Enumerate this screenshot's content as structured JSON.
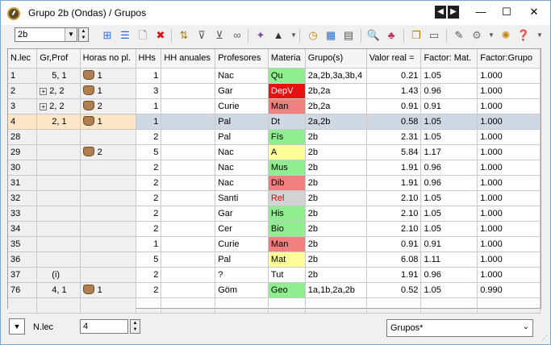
{
  "window": {
    "title": "Grupo 2b (Ondas) / Grupos",
    "nav_prev": "◀",
    "nav_next": "▶",
    "minimize": "—",
    "maximize": "☐",
    "close": "✕"
  },
  "toolbar": {
    "group_combo_value": "2b",
    "icons": [
      "new-row-icon",
      "list-icon",
      "new-document-icon",
      "delete-icon",
      "sort-icon",
      "filter-icon",
      "filter-add-icon",
      "link-icon",
      "magic-wand-icon",
      "graduation-cap-icon",
      "clock-icon",
      "timetable-icon",
      "matrix-icon",
      "search-icon",
      "people-icon",
      "copy-icon",
      "windows-icon",
      "edit-icon",
      "settings-icon",
      "gear-icon",
      "help-icon"
    ]
  },
  "grid": {
    "columns": [
      "N.lec",
      "Gr,Prof",
      "Horas no pl.",
      "HHs",
      "HH anuales",
      "Profesores",
      "Materia",
      "Grupo(s)",
      "Valor real =",
      "Factor: Mat.",
      "Factor:Grupo"
    ],
    "rows": [
      {
        "nlec": "1",
        "grprof": "5, 1",
        "expand": false,
        "hand": true,
        "horas": "1",
        "hhs": "1",
        "hhanual": "",
        "prof": "Nac",
        "materia": "Qu",
        "mcolor": "#90ee90",
        "mtext": "#000",
        "grupos": "2a,2b,3a,3b,4",
        "valor": "0.21",
        "fmat": "1.05",
        "fgrupo": "1.000",
        "sel": false
      },
      {
        "nlec": "2",
        "grprof": "2, 2",
        "expand": true,
        "hand": true,
        "horas": "1",
        "hhs": "3",
        "hhanual": "",
        "prof": "Gar",
        "materia": "DepV",
        "mcolor": "#e81010",
        "mtext": "#fff",
        "grupos": "2b,2a",
        "valor": "1.43",
        "fmat": "0.96",
        "fgrupo": "1.000",
        "sel": false
      },
      {
        "nlec": "3",
        "grprof": "2, 2",
        "expand": true,
        "hand": true,
        "horas": "2",
        "hhs": "1",
        "hhanual": "",
        "prof": "Curie",
        "materia": "Man",
        "mcolor": "#f08080",
        "mtext": "#000",
        "grupos": "2b,2a",
        "valor": "0.91",
        "fmat": "0.91",
        "fgrupo": "1.000",
        "sel": false
      },
      {
        "nlec": "4",
        "grprof": "2, 1",
        "expand": false,
        "hand": true,
        "horas": "1",
        "hhs": "1",
        "hhanual": "",
        "prof": "Pal",
        "materia": "Dt",
        "mcolor": "#cfd8e3",
        "mtext": "#000",
        "grupos": "2a,2b",
        "valor": "0.58",
        "fmat": "1.05",
        "fgrupo": "1.000",
        "sel": true
      },
      {
        "nlec": "28",
        "grprof": "",
        "expand": false,
        "hand": false,
        "horas": "",
        "hhs": "2",
        "hhanual": "",
        "prof": "Pal",
        "materia": "Fís",
        "mcolor": "#90ee90",
        "mtext": "#000",
        "grupos": "2b",
        "valor": "2.31",
        "fmat": "1.05",
        "fgrupo": "1.000",
        "sel": false
      },
      {
        "nlec": "29",
        "grprof": "",
        "expand": false,
        "hand": true,
        "horas": "2",
        "hhs": "5",
        "hhanual": "",
        "prof": "Nac",
        "materia": "A",
        "mcolor": "#ffff99",
        "mtext": "#000",
        "grupos": "2b",
        "valor": "5.84",
        "fmat": "1.17",
        "fgrupo": "1.000",
        "sel": false
      },
      {
        "nlec": "30",
        "grprof": "",
        "expand": false,
        "hand": false,
        "horas": "",
        "hhs": "2",
        "hhanual": "",
        "prof": "Nac",
        "materia": "Mus",
        "mcolor": "#90ee90",
        "mtext": "#000",
        "grupos": "2b",
        "valor": "1.91",
        "fmat": "0.96",
        "fgrupo": "1.000",
        "sel": false
      },
      {
        "nlec": "31",
        "grprof": "",
        "expand": false,
        "hand": false,
        "horas": "",
        "hhs": "2",
        "hhanual": "",
        "prof": "Nac",
        "materia": "Dib",
        "mcolor": "#f08080",
        "mtext": "#000",
        "grupos": "2b",
        "valor": "1.91",
        "fmat": "0.96",
        "fgrupo": "1.000",
        "sel": false
      },
      {
        "nlec": "32",
        "grprof": "",
        "expand": false,
        "hand": false,
        "horas": "",
        "hhs": "2",
        "hhanual": "",
        "prof": "Santi",
        "materia": "Rel",
        "mcolor": "#d3d3d3",
        "mtext": "#e00000",
        "grupos": "2b",
        "valor": "2.10",
        "fmat": "1.05",
        "fgrupo": "1.000",
        "sel": false
      },
      {
        "nlec": "33",
        "grprof": "",
        "expand": false,
        "hand": false,
        "horas": "",
        "hhs": "2",
        "hhanual": "",
        "prof": "Gar",
        "materia": "His",
        "mcolor": "#90ee90",
        "mtext": "#000",
        "grupos": "2b",
        "valor": "2.10",
        "fmat": "1.05",
        "fgrupo": "1.000",
        "sel": false
      },
      {
        "nlec": "34",
        "grprof": "",
        "expand": false,
        "hand": false,
        "horas": "",
        "hhs": "2",
        "hhanual": "",
        "prof": "Cer",
        "materia": "Bio",
        "mcolor": "#90ee90",
        "mtext": "#000",
        "grupos": "2b",
        "valor": "2.10",
        "fmat": "1.05",
        "fgrupo": "1.000",
        "sel": false
      },
      {
        "nlec": "35",
        "grprof": "",
        "expand": false,
        "hand": false,
        "horas": "",
        "hhs": "1",
        "hhanual": "",
        "prof": "Curie",
        "materia": "Man",
        "mcolor": "#f08080",
        "mtext": "#000",
        "grupos": "2b",
        "valor": "0.91",
        "fmat": "0.91",
        "fgrupo": "1.000",
        "sel": false
      },
      {
        "nlec": "36",
        "grprof": "",
        "expand": false,
        "hand": false,
        "horas": "",
        "hhs": "5",
        "hhanual": "",
        "prof": "Pal",
        "materia": "Mat",
        "mcolor": "#ffff99",
        "mtext": "#000",
        "grupos": "2b",
        "valor": "6.08",
        "fmat": "1.11",
        "fgrupo": "1.000",
        "sel": false
      },
      {
        "nlec": "37",
        "grprof": "(i)",
        "expand": false,
        "hand": false,
        "horas": "",
        "hhs": "2",
        "hhanual": "",
        "prof": "?",
        "materia": "Tut",
        "mcolor": "#ffffff",
        "mtext": "#000",
        "grupos": "2b",
        "valor": "1.91",
        "fmat": "0.96",
        "fgrupo": "1.000",
        "sel": false
      },
      {
        "nlec": "76",
        "grprof": "4, 1",
        "expand": false,
        "hand": true,
        "horas": "1",
        "hhs": "2",
        "hhanual": "",
        "prof": "Göm",
        "materia": "Geo",
        "mcolor": "#90ee90",
        "mtext": "#000",
        "grupos": "1a,1b,2a,2b",
        "valor": "0.52",
        "fmat": "1.05",
        "fgrupo": "0.990",
        "sel": false
      }
    ]
  },
  "bottom": {
    "field_label": "N.lec",
    "field_value": "4",
    "view_select": "Grupos*"
  }
}
